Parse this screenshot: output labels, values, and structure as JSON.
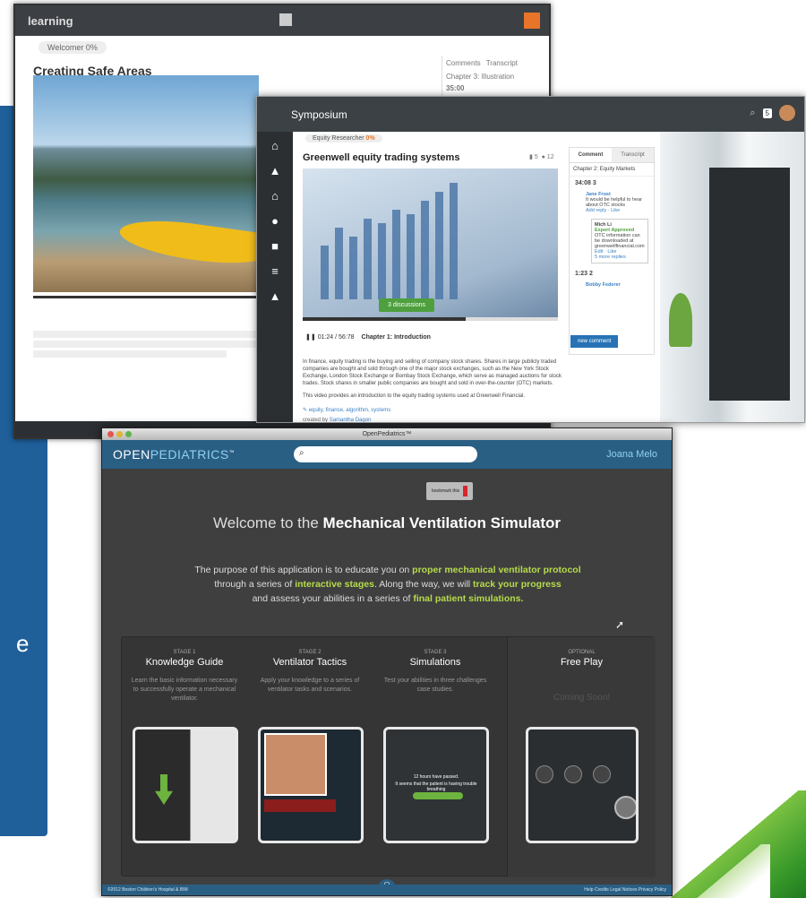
{
  "left_panel": {
    "fragments": [
      "e",
      "",
      "",
      "e"
    ]
  },
  "learning": {
    "app": "learning",
    "badge": "Welcomer 0%",
    "title": "Creating Safe Areas",
    "side_tabs": [
      "Comments",
      "Transcript"
    ],
    "side_chapter": "Chapter 3: Illustration",
    "side_time": "35:00"
  },
  "symposium": {
    "brand": "Symposium",
    "user_count": "5",
    "chip_label": "Equity Researcher",
    "chip_pct": "0%",
    "title": "Greenwell equity trading systems",
    "bookmarks": "5",
    "comments": "12",
    "discussions": "3 discussions",
    "time": "01:24 / 56:78",
    "chapter": "Chapter 1:  Introduction",
    "body_1": "In finance, equity trading is the buying and selling of company stock shares. Shares in large publicly traded companies are bought and sold through one of the major stock exchanges, such as the New York Stock Exchange, London Stock Exchange or Bombay Stock Exchange, which serve as managed auctions for stock trades. Stock shares in smaller public companies are bought and sold in over-the-counter (OTC) markets.",
    "body_2": "This video provides an introduction to the equity trading systems used at Greenwell Financial.",
    "tags": "equity, finance, algorithm, systems",
    "created_by": "created by",
    "author": "Samantha Dagon",
    "tab_comment": "Comment",
    "tab_transcript": "Transcript",
    "chapter_select": "Chapter 2: Equity Markets",
    "t1": "34:08",
    "t1_count": "3",
    "c1_user": "Jane Frost",
    "c1_text": "It would be helpful to hear about OTC stocks",
    "c1_actions": "Add reply · Like",
    "r_user": "Mich Li",
    "r_badge": "Expert Approved",
    "r_text": "OTC information can be downloaded at greenwellfinancial.com",
    "r_actions": "Edit · Like",
    "r_more": "5 more replies",
    "t2": "1:23",
    "t2_count": "2",
    "c2_user": "Bobby Federer",
    "new_comment": "new comment"
  },
  "openpediatrics": {
    "window_title": "OpenPediatrics™",
    "logo_open": "OPEN",
    "logo_ped": "PEDIATRICS",
    "logo_tm": "™",
    "user": "Joana Melo",
    "bookmark": "bookmark this",
    "welcome_pre": "Welcome to the ",
    "welcome_bold": "Mechanical Ventilation Simulator",
    "p1": "The purpose of this application is to educate you on ",
    "p1g": "proper mechanical ventilator protocol",
    "p2": "through a series of ",
    "p2g": "interactive stages",
    "p3": ". Along the way, we will ",
    "p3g": "track your progress",
    "p4": "and assess your abilities in a series of ",
    "p4g": "final patient simulations.",
    "stages": [
      {
        "label": "STAGE 1",
        "name": "Knowledge Guide",
        "desc": "Learn the basic information necessary to successfully operate a mechanical ventilator."
      },
      {
        "label": "STAGE 2",
        "name": "Ventilator Tactics",
        "desc": "Apply your knowledge to a series of ventilator tasks and scenarios."
      },
      {
        "label": "STAGE 3",
        "name": "Simulations",
        "desc": "Test your abilities in three challenges case studies."
      },
      {
        "label": "OPTIONAL",
        "name": "Free Play",
        "desc": "",
        "soon": "Coming Soon!"
      }
    ],
    "sim_msg": "12 hours have passed.",
    "sim_msg2": "It seems that the patient is having trouble breathing",
    "footer_left": "©2012 Boston Children's Hospital & IBM",
    "footer_right": "Help   Credits   Legal Notices   Privacy Policy"
  }
}
